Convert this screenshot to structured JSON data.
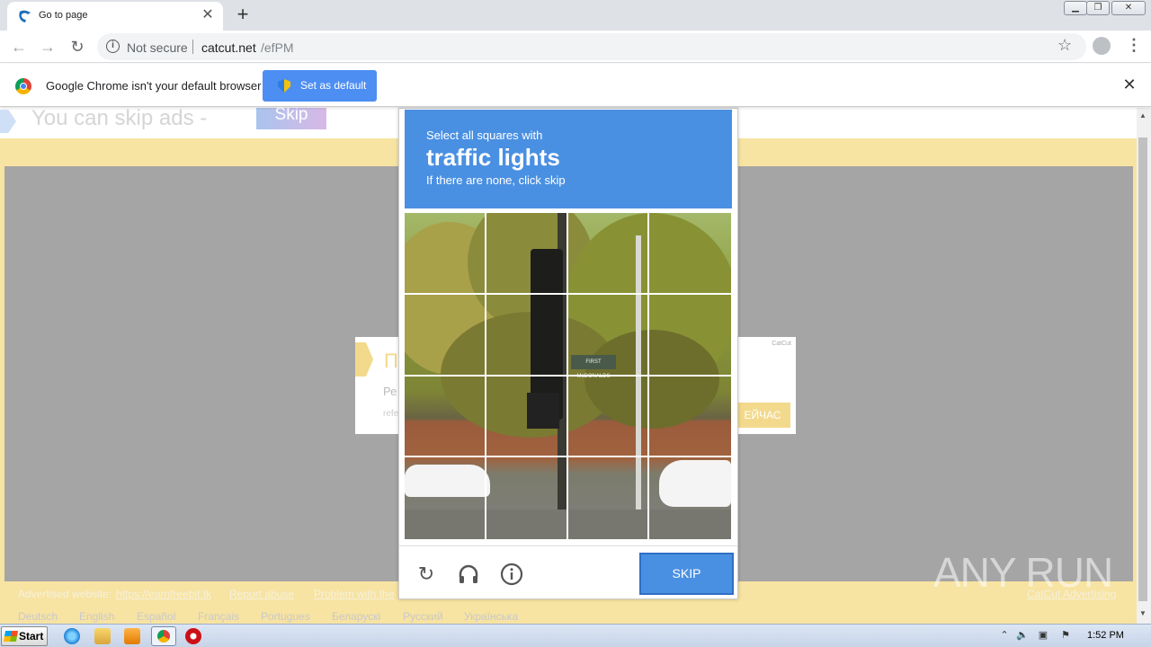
{
  "browser": {
    "tab": {
      "title": "Go to page",
      "close": "✕"
    },
    "new_tab": "+",
    "security_label": "Not secure",
    "url_host": "catcut.net",
    "url_path": "/efPM",
    "window_controls": [
      "minimize",
      "restore",
      "close"
    ]
  },
  "infobar": {
    "message": "Google Chrome isn't your default browser",
    "set_default_label": "Set as default",
    "close": "✕"
  },
  "page": {
    "skip_ads_text": "You can skip ads  -",
    "skip_label": "Skip",
    "ad": {
      "heading": "П",
      "line1": "Ре",
      "line2": "refe",
      "brand": "CatCut",
      "button": "ЕЙЧАС"
    },
    "footer": {
      "advertised_label": "Advertised website:",
      "advertised_link": "https://earnfreebit.tk",
      "report_abuse": "Report abuse",
      "problem": "Problem with the",
      "catcut_adv": "CatCut Advertising"
    },
    "languages": [
      "Deutsch",
      "English",
      "Español",
      "Français",
      "Portugues",
      "Беларускі",
      "Русский",
      "Українська"
    ]
  },
  "captcha": {
    "line1": "Select all squares with",
    "target": "traffic lights",
    "line3": "If there are none, click skip",
    "sign_text": "FIRST McDONALDS",
    "skip_label": "SKIP",
    "icons": [
      "reload-icon",
      "headphones-icon",
      "info-icon"
    ]
  },
  "taskbar": {
    "start_label": "Start",
    "time": "1:52 PM",
    "apps": [
      "ie-icon",
      "explorer-icon",
      "media-player-icon",
      "chrome-icon",
      "opera-icon"
    ]
  },
  "watermark": {
    "text": "ANY RUN"
  },
  "colors": {
    "captcha_blue": "#4a90e2",
    "page_yellow": "#f7e3a2",
    "page_gray": "#a5a5a5",
    "chrome_button": "#4d8ef3"
  }
}
